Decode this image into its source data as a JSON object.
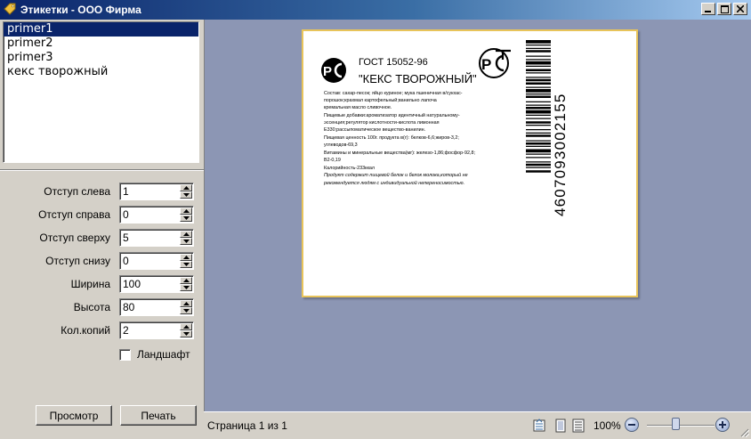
{
  "window": {
    "title": "Этикетки - ООО Фирма",
    "icon": "tag-icon"
  },
  "list": {
    "items": [
      {
        "label": "primer1",
        "selected": true
      },
      {
        "label": "primer2",
        "selected": false
      },
      {
        "label": "primer3",
        "selected": false
      },
      {
        "label": "кекс творожный",
        "selected": false
      }
    ]
  },
  "settings": {
    "fields": [
      {
        "label": "Отступ слева",
        "value": "1"
      },
      {
        "label": "Отступ справа",
        "value": "0"
      },
      {
        "label": "Отступ сверху",
        "value": "5"
      },
      {
        "label": "Отступ снизу",
        "value": "0"
      },
      {
        "label": "Ширина",
        "value": "100"
      },
      {
        "label": "Высота",
        "value": "80"
      },
      {
        "label": "Кол.копий",
        "value": "2"
      }
    ],
    "landscape_label": "Ландшафт",
    "landscape_checked": false
  },
  "buttons": {
    "preview": "Просмотр",
    "print": "Печать"
  },
  "label": {
    "gost": "ГОСТ 15052-96",
    "product": "\"КЕКС ТВОРОЖНЫЙ\"",
    "composition": [
      "Состав: сахар-песок; яйцо куриное; мука пшеничная в/сукхас-",
      "порошок;крахмал картофельный;ванильно лапоча",
      "кремальная масло сливочное.",
      "Пищевые добавки:ароматизатор идентичный натуральному-",
      "эссенция;регулятор кислотности-кислота лимонная",
      "Е330;рассыпоматическое вещество-ванилин.",
      "Пищевая ценность 100г. продукта в(г): белков-6,6;жиров-3,2;",
      "углеводов-69,3",
      "Витамины и минеральные вещества(мг): железо-1,86;фосфор-92,8;",
      "В2-0,19",
      "Калорийность-233ккал"
    ],
    "note": [
      "Продукт содержит пищевой белок и белок молока,который не",
      "рекомендуется людям с индивидуальной непереносимостью."
    ],
    "barcode": "4607093002155"
  },
  "status": {
    "page_info": "Страница 1 из 1",
    "zoom": "100%"
  }
}
